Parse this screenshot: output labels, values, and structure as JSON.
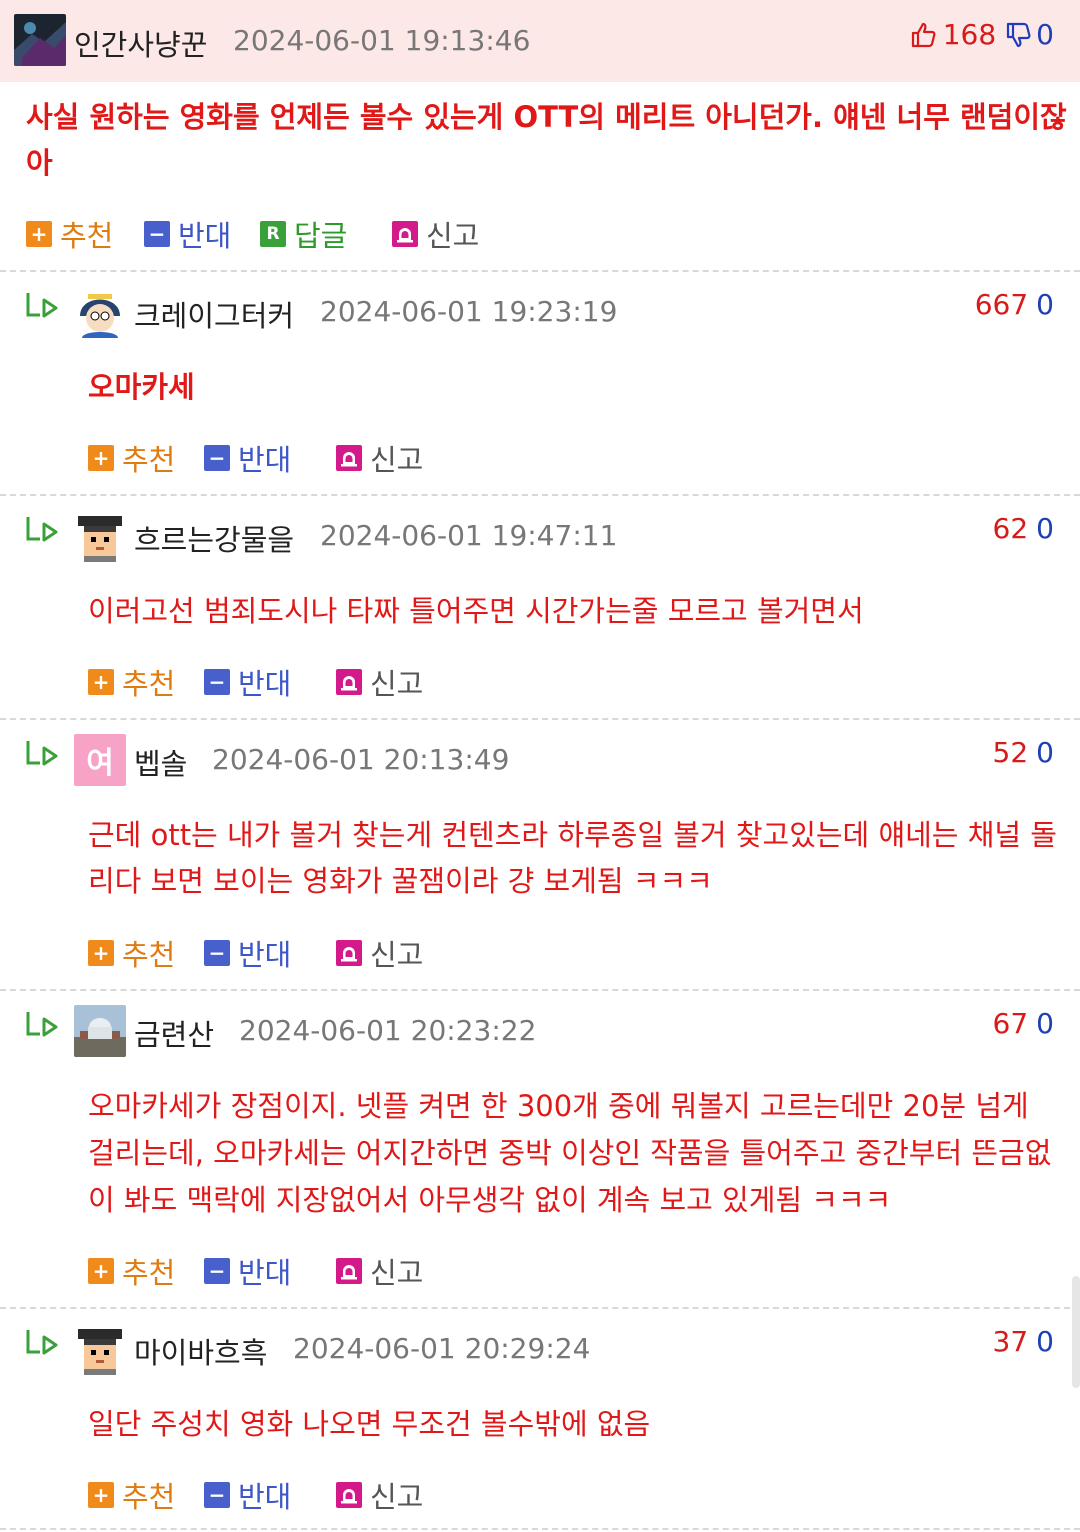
{
  "post": {
    "author": "인간사냥꾼",
    "time": "2024-06-01 19:13:46",
    "up": "168",
    "down": "0",
    "content_line1": "사실 원하는 영화를 언제든 볼수 있는게 OTT의 메리트 아니던가. 얘넨 너무 랜덤이잖",
    "content_line2": "아"
  },
  "labels": {
    "recommend": "추천",
    "oppose": "반대",
    "reply": "답글",
    "report": "신고",
    "recommend_icon": "+",
    "oppose_icon": "−",
    "reply_icon": "R"
  },
  "comments": [
    {
      "author": "크레이그터커",
      "time": "2024-06-01 19:23:19",
      "up": "667",
      "down": "0",
      "lines": [
        "오마카세"
      ]
    },
    {
      "author": "흐르는강물을",
      "time": "2024-06-01 19:47:11",
      "up": "62",
      "down": "0",
      "lines": [
        "이러고선 범죄도시나 타짜 틀어주면 시간가는줄 모르고 볼거면서"
      ]
    },
    {
      "author": "벱솔",
      "time": "2024-06-01 20:13:49",
      "up": "52",
      "down": "0",
      "avatar_text": "여",
      "lines": [
        "근데 ott는 내가 볼거 찾는게 컨텐츠라 하루종일 볼거 찾고있는데 얘네는 채널 돌",
        "리다 보면 보이는 영화가 꿀잼이라 걍 보게됨 ㅋㅋㅋ"
      ]
    },
    {
      "author": "금련산",
      "time": "2024-06-01 20:23:22",
      "up": "67",
      "down": "0",
      "lines": [
        "오마카세가 장점이지. 넷플 켜면 한 300개 중에 뭐볼지 고르는데만 20분 넘게",
        "걸리는데, 오마카세는 어지간하면 중박 이상인 작품을 틀어주고 중간부터 뜬금없",
        "이 봐도 맥락에 지장없어서 아무생각 없이 계속 보고 있게됨 ㅋㅋㅋ"
      ]
    },
    {
      "author": "마이바흐흑",
      "time": "2024-06-01 20:29:24",
      "up": "37",
      "down": "0",
      "lines": [
        "일단 주성치 영화 나오면 무조건 볼수밖에 없음"
      ]
    }
  ],
  "colors": {
    "accent_red": "#e01818",
    "header_bg": "#fde8e8",
    "recommend": "#f08a1a",
    "oppose": "#4860cc",
    "reply": "#3aa13a",
    "report": "#d4198a"
  }
}
